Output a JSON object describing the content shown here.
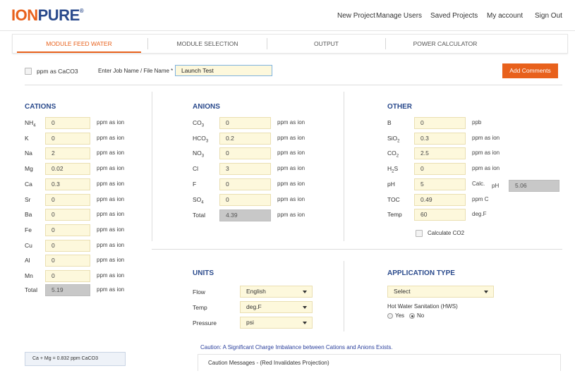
{
  "header": {
    "logo_ion": "ION",
    "logo_pure": "PURE",
    "logo_reg": "®",
    "nav": [
      "New Project",
      "Manage Users",
      "Saved Projects",
      "My account",
      "Sign Out"
    ]
  },
  "tabs": [
    "MODULE FEED WATER",
    "MODULE SELECTION",
    "OUTPUT",
    "POWER CALCULATOR"
  ],
  "active_tab": "MODULE FEED WATER",
  "job": {
    "ppm_caco3_label": "ppm as CaCO3",
    "ppm_caco3_checked": false,
    "job_label": "Enter Job Name / File Name *",
    "job_value": "Launch Test",
    "add_comments": "Add Comments"
  },
  "cations": {
    "title": "CATIONS",
    "rows": [
      {
        "base": "NH",
        "sub": "4",
        "value": "0",
        "unit": "ppm as ion"
      },
      {
        "base": "K",
        "sub": "",
        "value": "0",
        "unit": "ppm as ion"
      },
      {
        "base": "Na",
        "sub": "",
        "value": "2",
        "unit": "ppm as ion"
      },
      {
        "base": "Mg",
        "sub": "",
        "value": "0.02",
        "unit": "ppm as ion"
      },
      {
        "base": "Ca",
        "sub": "",
        "value": "0.3",
        "unit": "ppm as ion"
      },
      {
        "base": "Sr",
        "sub": "",
        "value": "0",
        "unit": "ppm as ion"
      },
      {
        "base": "Ba",
        "sub": "",
        "value": "0",
        "unit": "ppm as ion"
      },
      {
        "base": "Fe",
        "sub": "",
        "value": "0",
        "unit": "ppm as ion"
      },
      {
        "base": "Cu",
        "sub": "",
        "value": "0",
        "unit": "ppm as ion"
      },
      {
        "base": "Al",
        "sub": "",
        "value": "0",
        "unit": "ppm as ion"
      },
      {
        "base": "Mn",
        "sub": "",
        "value": "0",
        "unit": "ppm as ion"
      }
    ],
    "total_label": "Total",
    "total_value": "5.19",
    "total_unit": "ppm as ion"
  },
  "anions": {
    "title": "ANIONS",
    "rows": [
      {
        "base": "CO",
        "sub": "3",
        "value": "0",
        "unit": "ppm as ion"
      },
      {
        "base": "HCO",
        "sub": "3",
        "value": "0.2",
        "unit": "ppm as ion"
      },
      {
        "base": "NO",
        "sub": "3",
        "value": "0",
        "unit": "ppm as ion"
      },
      {
        "base": "Cl",
        "sub": "",
        "value": "3",
        "unit": "ppm as ion"
      },
      {
        "base": "F",
        "sub": "",
        "value": "0",
        "unit": "ppm as ion"
      },
      {
        "base": "SO",
        "sub": "4",
        "value": "0",
        "unit": "ppm as ion"
      }
    ],
    "total_label": "Total",
    "total_value": "4.39",
    "total_unit": "ppm as ion"
  },
  "other": {
    "title": "OTHER",
    "rows": [
      {
        "base": "B",
        "sub": "",
        "value": "0",
        "unit": "ppb"
      },
      {
        "base": "SiO",
        "sub": "2",
        "value": "0.3",
        "unit": "ppm as ion"
      },
      {
        "base": "CO",
        "sub": "2",
        "value": "2.5",
        "unit": "ppm as ion"
      },
      {
        "base": "H",
        "sub": "2",
        "base2": "S",
        "value": "0",
        "unit": "ppm as ion"
      },
      {
        "base": "pH",
        "sub": "",
        "value": "5",
        "unit": "Calc."
      },
      {
        "base": "TOC",
        "sub": "",
        "value": "0.49",
        "unit": "ppm C"
      },
      {
        "base": "Temp",
        "sub": "",
        "value": "60",
        "unit": "deg.F"
      }
    ],
    "calc_ph_label": "pH",
    "calc_ph_value": "5.06",
    "calculate_co2_label": "Calculate CO2",
    "calculate_co2_checked": false
  },
  "units": {
    "title": "UNITS",
    "rows": [
      {
        "label": "Flow",
        "value": "English"
      },
      {
        "label": "Temp",
        "value": "deg.F"
      },
      {
        "label": "Pressure",
        "value": "psi"
      }
    ]
  },
  "application": {
    "title": "APPLICATION TYPE",
    "select_value": "Select",
    "hws_label": "Hot Water Sanitation (HWS)",
    "yes_label": "Yes",
    "no_label": "No",
    "selected": "No"
  },
  "camg_text": "Ca + Mg = 0.832  ppm CaCO3",
  "caution_text": "Caution: A Significant Charge Imbalance between Cations and Anions Exists.",
  "caution_messages_label": "Caution Messages - (Red Invalidates Projection)"
}
